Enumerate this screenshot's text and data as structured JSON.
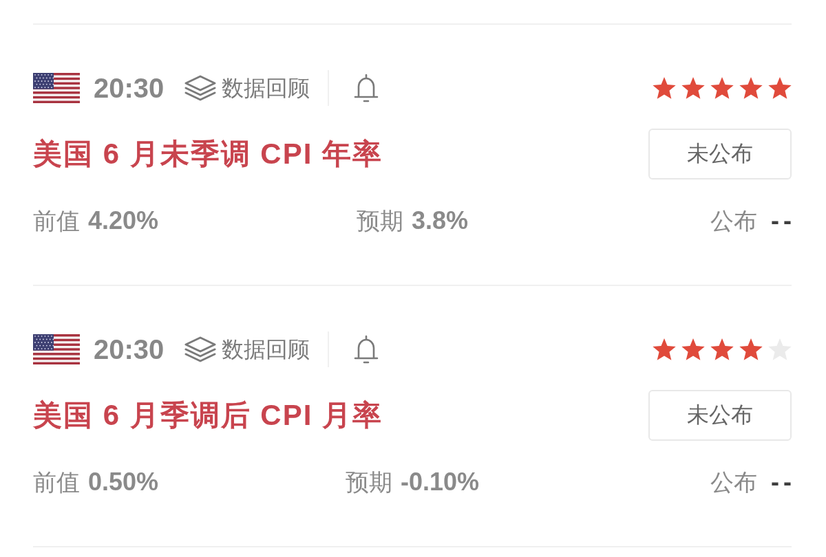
{
  "events": [
    {
      "time": "20:30",
      "review": "数据回顾",
      "stars": 5,
      "title": "美国 6 月未季调 CPI 年率",
      "status": "未公布",
      "figures": [
        {
          "kind": "previous",
          "label": "前值",
          "value": "4.20%"
        },
        {
          "kind": "forecast",
          "label": "预期",
          "value": "3.8%"
        },
        {
          "kind": "actual",
          "label": "公布",
          "value": "--"
        }
      ]
    },
    {
      "time": "20:30",
      "review": "数据回顾",
      "stars": 4,
      "title": "美国 6 月季调后 CPI 月率",
      "status": "未公布",
      "figures": [
        {
          "kind": "previous",
          "label": "前值",
          "value": "0.50%"
        },
        {
          "kind": "forecast",
          "label": "预期",
          "value": "-0.10%"
        },
        {
          "kind": "actual",
          "label": "公布",
          "value": "--"
        }
      ]
    }
  ]
}
